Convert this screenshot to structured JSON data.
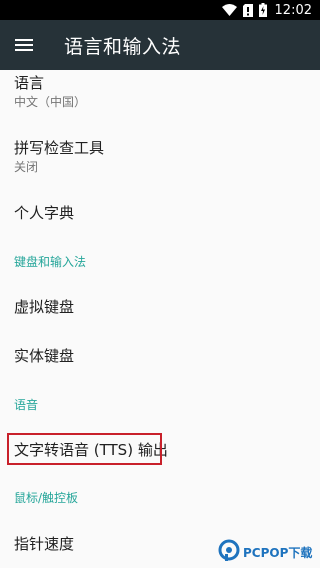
{
  "status_bar": {
    "time": "12:02",
    "icons": [
      "wifi-icon",
      "no-sim-icon",
      "battery-charging-icon"
    ]
  },
  "app_bar": {
    "title": "语言和输入法",
    "menu_icon": "menu-icon"
  },
  "items": [
    {
      "title": "语言",
      "summary": "中文（中国）"
    },
    {
      "title": "拼写检查工具",
      "summary": "关闭"
    },
    {
      "title": "个人字典"
    },
    {
      "category": "键盘和输入法"
    },
    {
      "title": "虚拟键盘"
    },
    {
      "title": "实体键盘"
    },
    {
      "category": "语音"
    },
    {
      "title": "文字转语音 (TTS) 输出"
    },
    {
      "category": "鼠标/触控板"
    },
    {
      "title": "指针速度"
    }
  ],
  "watermark": {
    "brand": "PCPOP下载",
    "logo_icon": "pcpop-logo-icon"
  },
  "colors": {
    "status_bar": "#000000",
    "app_bar": "#263238",
    "category": "#26a69a",
    "highlight_border": "#c8202a"
  }
}
